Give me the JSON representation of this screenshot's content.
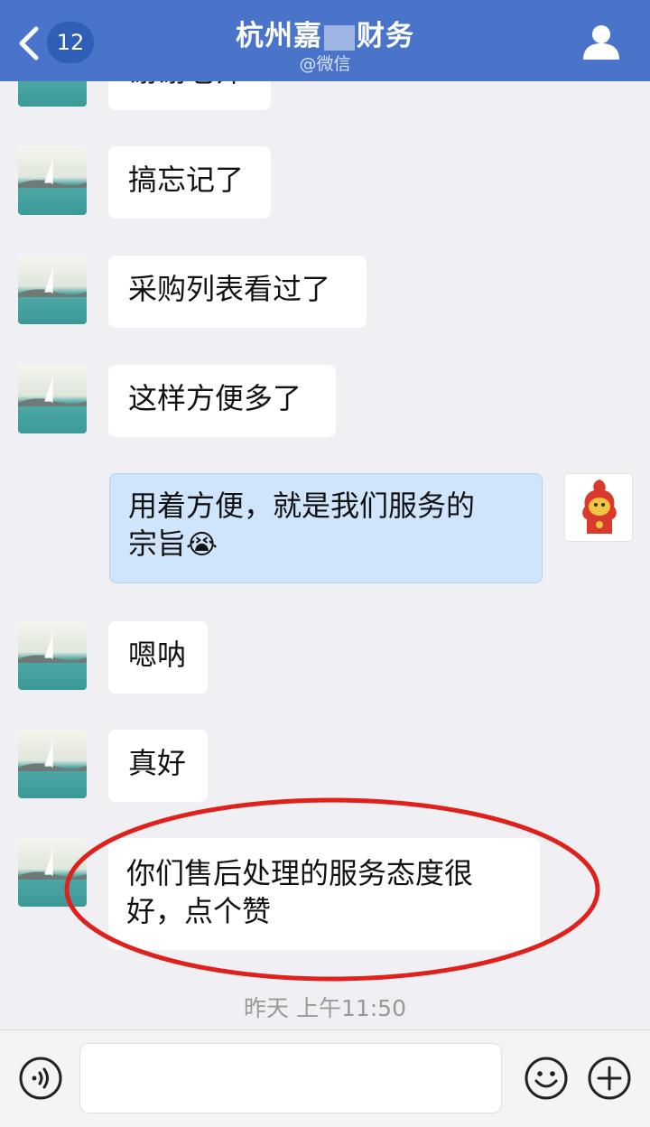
{
  "header": {
    "unread_count": "12",
    "title_prefix": "杭州嘉",
    "title_suffix": "财务",
    "subtitle": "@微信"
  },
  "messages": [
    {
      "side": "left",
      "text": "谢谢老师"
    },
    {
      "side": "left",
      "text": "搞忘记了"
    },
    {
      "side": "left",
      "text": "采购列表看过了"
    },
    {
      "side": "left",
      "text": "这样方便多了"
    },
    {
      "side": "right",
      "line1": "用着方便，就是我们服务的",
      "line2": "宗旨",
      "emoji": "😭"
    },
    {
      "side": "left",
      "text": "嗯呐"
    },
    {
      "side": "left",
      "text": "真好"
    },
    {
      "side": "left",
      "line1": "你们售后处理的服务态度很",
      "line2": "好，点个赞",
      "highlighted": true
    }
  ],
  "timestamp": "昨天 上午11:50",
  "input_bar": {
    "voice_icon": "voice-icon",
    "emoji_icon": "smiley-icon",
    "more_icon": "plus-icon",
    "input_value": ""
  },
  "colors": {
    "header_bg": "#4a74c9",
    "outgoing_bubble": "#cfe5fc",
    "annotation_circle": "#e0201a"
  }
}
